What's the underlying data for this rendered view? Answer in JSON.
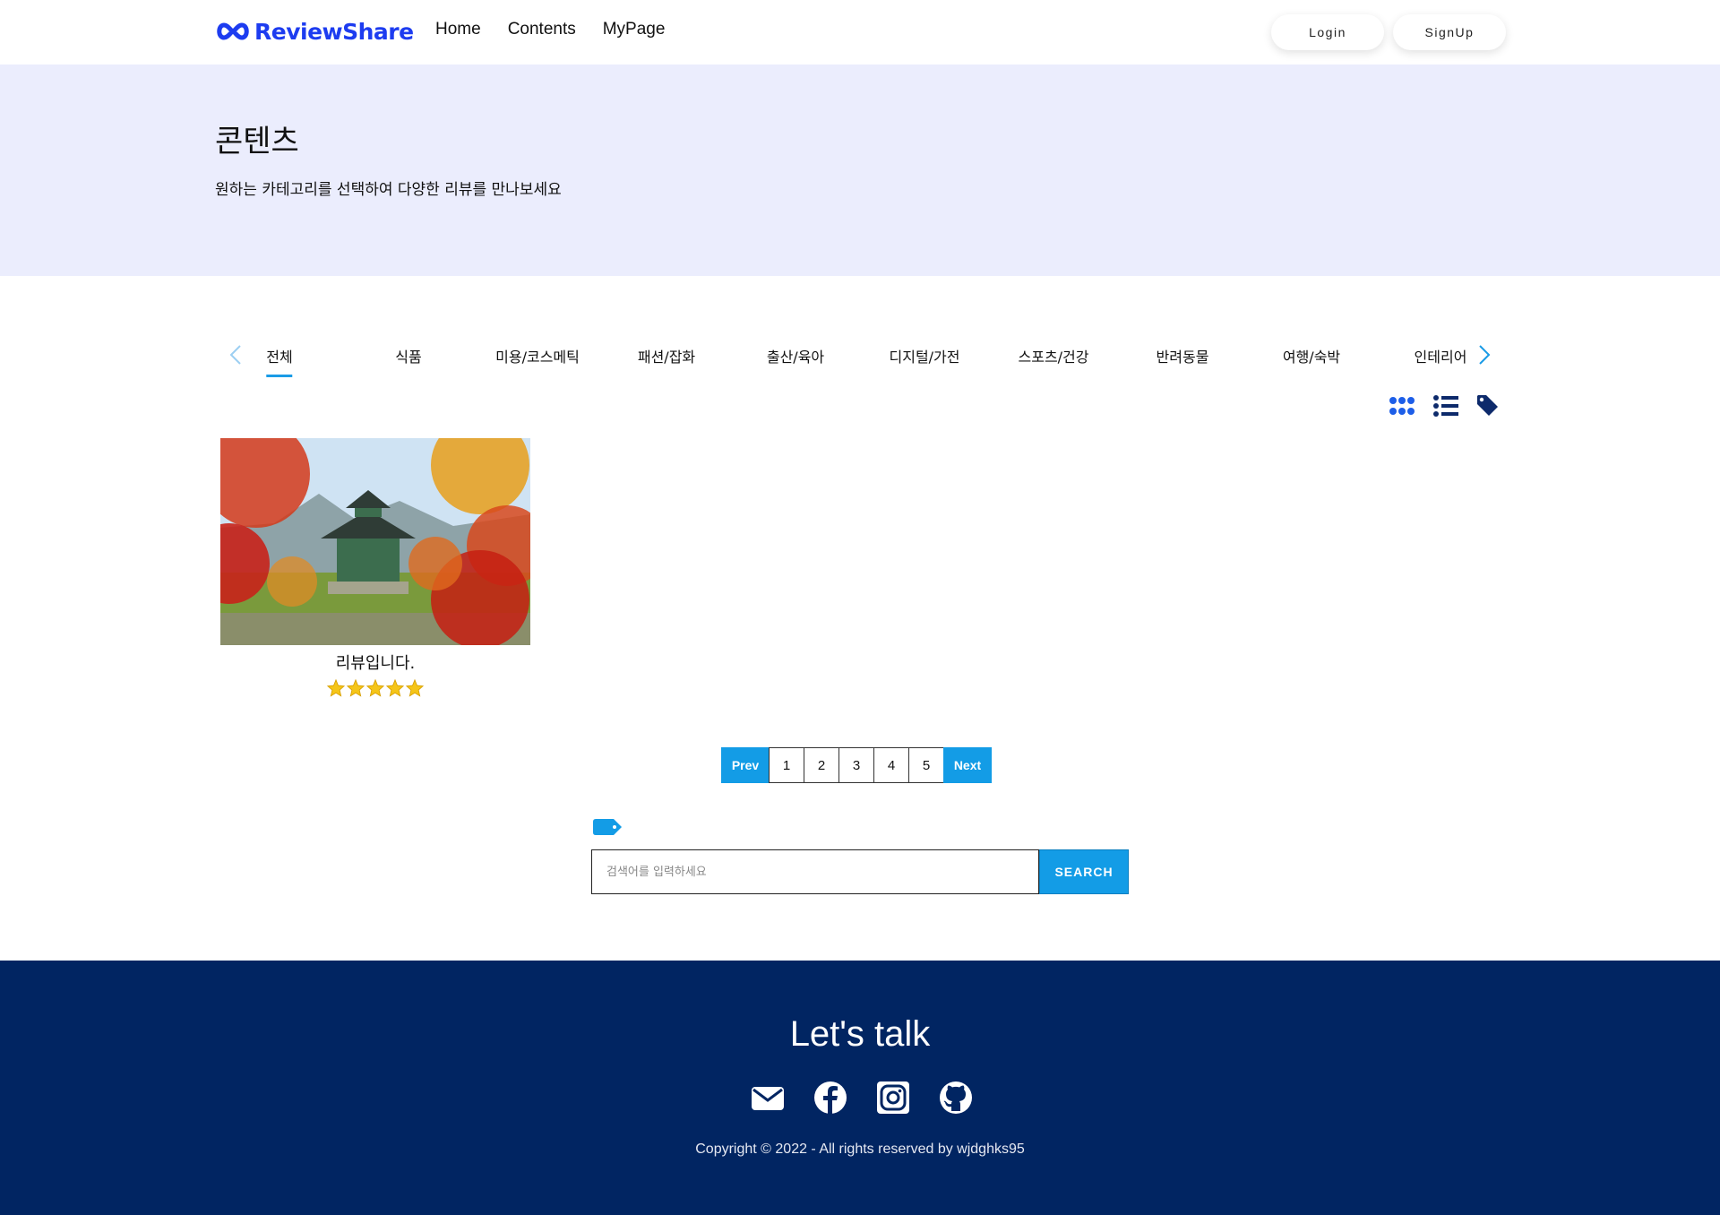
{
  "header": {
    "brand": "ReviewShare",
    "brand_color": "#1d3cf0",
    "nav": [
      "Home",
      "Contents",
      "MyPage"
    ],
    "login_label": "Login",
    "signup_label": "SignUp"
  },
  "hero": {
    "title": "콘텐츠",
    "subtitle": "원하는 카테고리를 선택하여 다양한 리뷰를 만나보세요",
    "background": "#ebedfd"
  },
  "categories": {
    "items": [
      "전체",
      "식품",
      "미용/코스메틱",
      "패션/잡화",
      "출산/육아",
      "디지털/가전",
      "스포츠/건강",
      "반려동물",
      "여행/숙박",
      "인테리어"
    ],
    "active": "전체",
    "accent": "#1a9be6"
  },
  "view_icons": [
    "grid-view-icon",
    "list-view-icon",
    "tag-icon"
  ],
  "reviews": [
    {
      "title": "리뷰입니다.",
      "rating": 5,
      "image": "autumn-pavilion-photo"
    }
  ],
  "pagination": {
    "prev_label": "Prev",
    "pages": [
      "1",
      "2",
      "3",
      "4",
      "5"
    ],
    "next_label": "Next"
  },
  "search": {
    "placeholder": "검색어를 입력하세요",
    "button_label": "SEARCH"
  },
  "footer": {
    "title": "Let's talk",
    "socials": [
      "mail-icon",
      "facebook-icon",
      "instagram-icon",
      "github-icon"
    ],
    "copyright": "Copyright © 2022 - All rights reserved by wjdghks95",
    "background": "#012562"
  }
}
